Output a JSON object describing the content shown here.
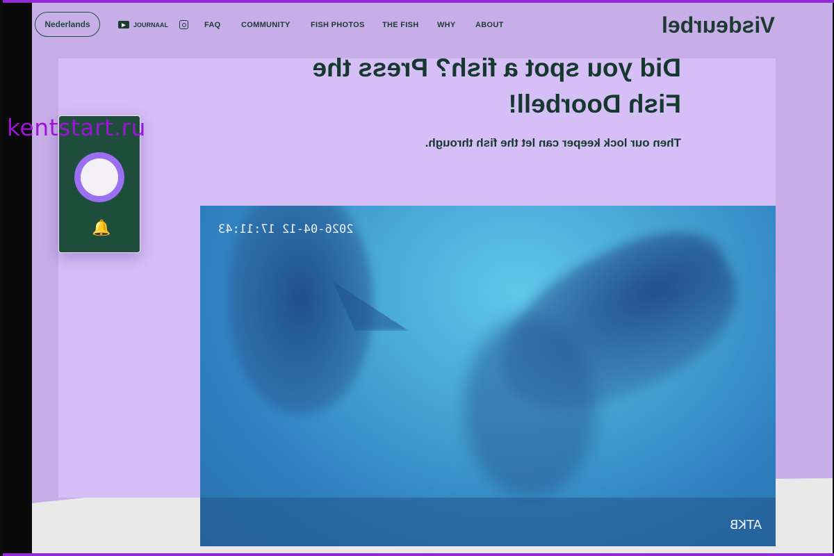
{
  "site": {
    "brand": "Visdeurbel",
    "language_button": "Nederlands"
  },
  "nav": {
    "items": [
      "ABOUT",
      "WHY",
      "THE FISH",
      "FISH PHOTOS",
      "COMMUNITY",
      "FAQ"
    ],
    "journaal": "JOURNAAL"
  },
  "hero": {
    "headline_line1": "Did you spot a fish? Press the",
    "headline_line2": "Fish Doorbell!",
    "subline": "Then our lock keeper can let the fish through."
  },
  "video": {
    "timestamp": "2026-04-12 17:11:43",
    "camera_label": "ATKB"
  },
  "watermark": "kentstart.ru",
  "icons": {
    "doorbell": "bell-icon",
    "instagram": "instagram-icon",
    "journaal": "play-icon"
  },
  "colors": {
    "page_bg": "#c8aee8",
    "hero_bg": "#d6bff6",
    "brand_dark": "#1c3b33",
    "doorbell_card": "#1f4d3c",
    "doorbell_ring": "#9b6ff2",
    "bell": "#f0c31c",
    "watermark": "#9d14d8"
  }
}
